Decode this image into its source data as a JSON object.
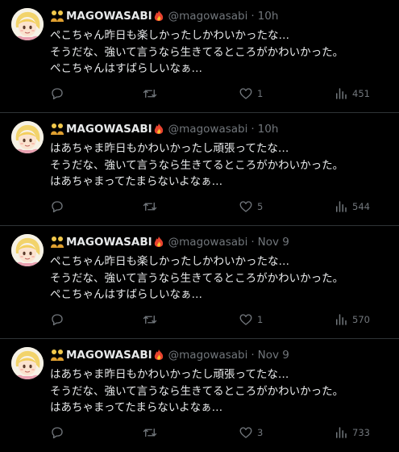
{
  "tweets": [
    {
      "display_name": "MAGOWASABI",
      "handle": "@magowasabi",
      "separator": "·",
      "time": "10h",
      "lines": [
        "ぺこちゃん昨日も楽しかったしかわいかったな…",
        "そうだな、強いて言うなら生きてるところがかわいかった。",
        "ぺこちゃんはすばらしいなぁ…"
      ],
      "likes": "1",
      "views": "451"
    },
    {
      "display_name": "MAGOWASABI",
      "handle": "@magowasabi",
      "separator": "·",
      "time": "10h",
      "lines": [
        "はあちゃま昨日もかわいかったし頑張ってたな…",
        "そうだな、強いて言うなら生きてるところがかわいかった。",
        "はあちゃまってたまらないよなぁ…"
      ],
      "likes": "5",
      "views": "544"
    },
    {
      "display_name": "MAGOWASABI",
      "handle": "@magowasabi",
      "separator": "·",
      "time": "Nov 9",
      "lines": [
        "ぺこちゃん昨日も楽しかったしかわいかったな…",
        "そうだな、強いて言うなら生きてるところがかわいかった。",
        "ぺこちゃんはすばらしいなぁ…"
      ],
      "likes": "1",
      "views": "570"
    },
    {
      "display_name": "MAGOWASABI",
      "handle": "@magowasabi",
      "separator": "·",
      "time": "Nov 9",
      "lines": [
        "はあちゃま昨日もかわいかったし頑張ってたな…",
        "そうだな、強いて言うなら生きてるところがかわいかった。",
        "はあちゃまってたまらないよなぁ…"
      ],
      "likes": "3",
      "views": "733"
    }
  ],
  "icons": {
    "name_prefix": "two-people-icon",
    "name_suffix": "fire-icon",
    "reply": "reply-icon",
    "retweet": "retweet-icon",
    "like": "like-icon",
    "views": "views-icon"
  },
  "colors": {
    "background": "#000000",
    "text": "#e7e9ea",
    "muted": "#71767b",
    "divider": "#2f3336"
  }
}
